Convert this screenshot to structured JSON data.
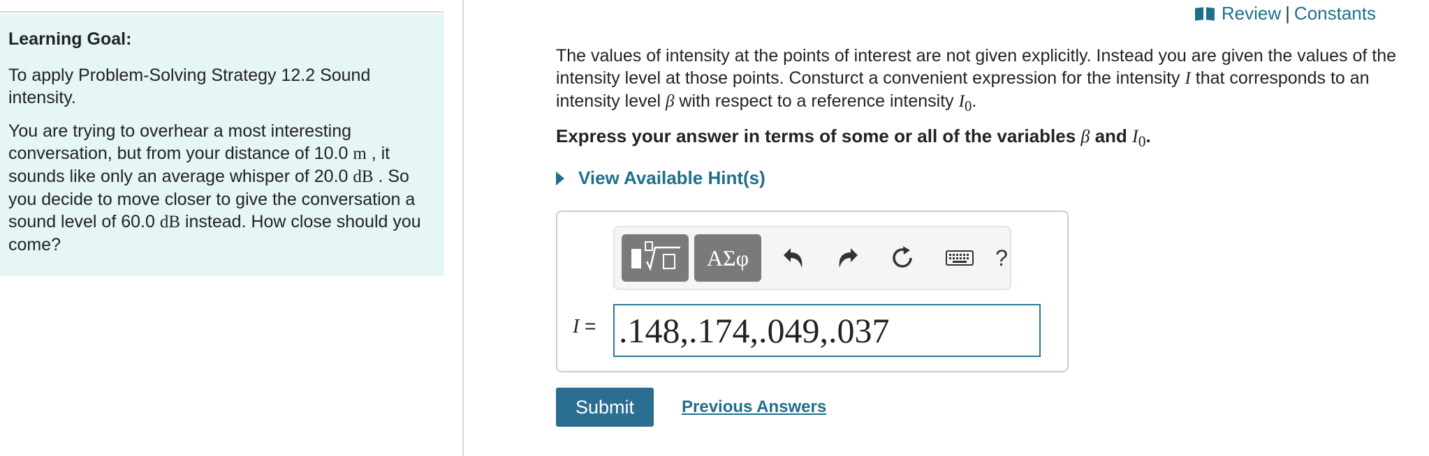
{
  "top_links": {
    "review": "Review",
    "separator": "|",
    "constants": "Constants",
    "icon": "book-icon"
  },
  "left_panel": {
    "title": "Learning Goal:",
    "goal": "To apply Problem-Solving Strategy 12.2 Sound intensity.",
    "problem_parts": {
      "a": "You are trying to overhear a most interesting conversation, but from your distance of 10.0 ",
      "unit_m": "m",
      "b": " , it sounds like only an average whisper of 20.0 ",
      "unit_db1": "dB",
      "c": " . So you decide to move closer to give the conversation a sound level of 60.0 ",
      "unit_db2": "dB",
      "d": " instead. How close should you come?"
    }
  },
  "question": {
    "part1": "The values of intensity at the points of interest are not given explicitly. Instead you are given the values of the intensity level at those points. Consturct a convenient expression for the intensity ",
    "var_I": "I",
    "part2": " that corresponds to an intensity level ",
    "var_beta": "β",
    "part3": " with respect to a reference intensity ",
    "var_I0": "I",
    "sub_0": "0",
    "part4": "."
  },
  "instruction": {
    "prefix": "Express your answer in terms of some or all of the variables ",
    "var_beta": "β",
    "middle": " and ",
    "var_I0": "I",
    "sub_0": "0",
    "suffix": "."
  },
  "hints": {
    "label": "View Available Hint(s)"
  },
  "toolbar": {
    "symbols_label": "ΑΣφ",
    "help_label": "?",
    "icons": [
      "templates-icon",
      "undo-icon",
      "redo-icon",
      "reset-icon",
      "keyboard-icon"
    ]
  },
  "answer": {
    "variable": "I",
    "equals": " =",
    "value": ".148,.174,.049,.037"
  },
  "actions": {
    "submit": "Submit",
    "previous_answers": "Previous Answers"
  },
  "colors": {
    "accent": "#1f6f8b",
    "panel_bg": "#e6f5f5",
    "submit_bg": "#2a6f92"
  }
}
